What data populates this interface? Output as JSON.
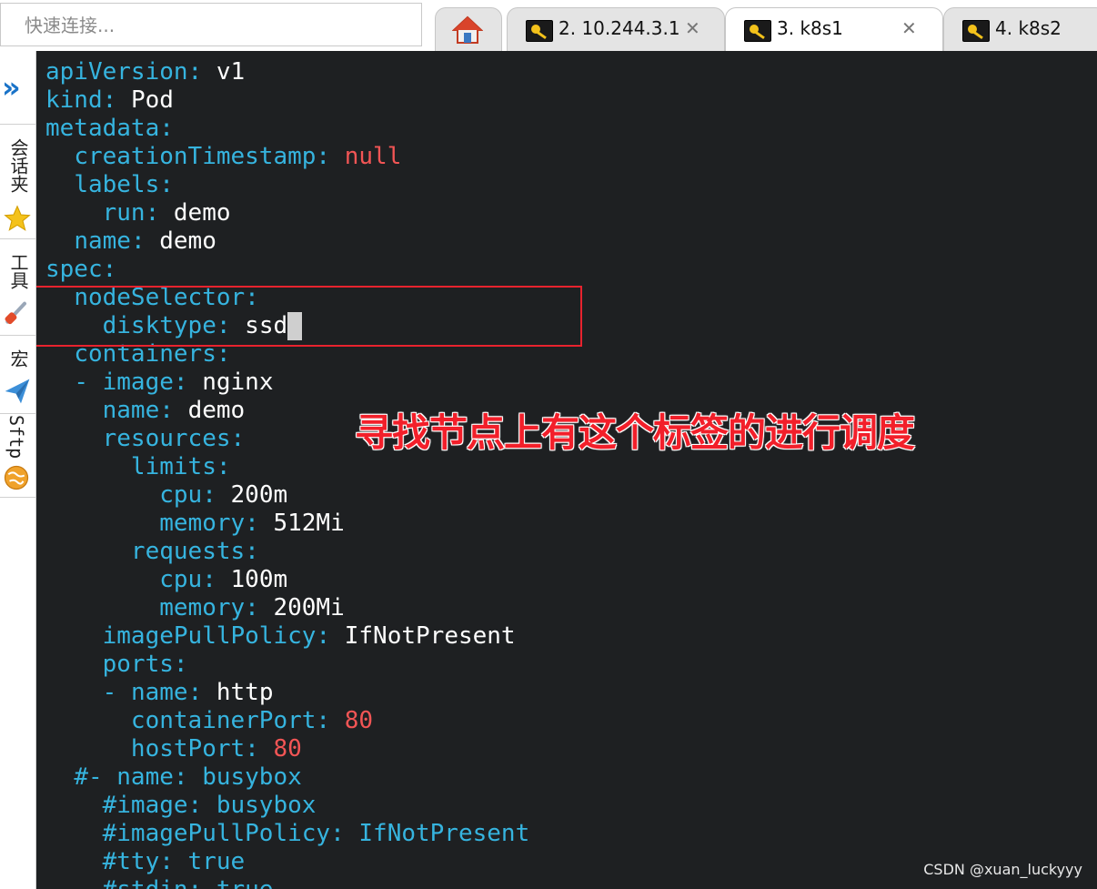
{
  "quick_connect": {
    "placeholder": "快速连接..."
  },
  "tabs": [
    {
      "label": "2. 10.244.3.1",
      "active": false
    },
    {
      "label": "3. k8s1",
      "active": true
    },
    {
      "label": "4. k8s2",
      "active": false
    }
  ],
  "icons": {
    "home": "home-icon",
    "key": "key-icon",
    "close": "close-icon",
    "chevron": "double-chevron-icon",
    "star": "star-icon",
    "tools": "wrench-icon",
    "macro": "paper-plane-icon",
    "sftp": "globe-icon"
  },
  "sidebar": {
    "chevron": "»",
    "items": [
      {
        "label": "会话夹"
      },
      {
        "label": "工具"
      },
      {
        "label": "宏"
      },
      {
        "label": "Sftp"
      }
    ]
  },
  "editor": {
    "colors": {
      "key": "#36b4df",
      "value": "#ffffff",
      "number": "#f25555",
      "background": "#1e2022",
      "highlight": "#e8232e"
    },
    "lines": [
      [
        [
          "k",
          "apiVersion"
        ],
        [
          "k",
          ": "
        ],
        [
          "v",
          "v1"
        ]
      ],
      [
        [
          "k",
          "kind"
        ],
        [
          "k",
          ": "
        ],
        [
          "v",
          "Pod"
        ]
      ],
      [
        [
          "k",
          "metadata"
        ],
        [
          "k",
          ":"
        ]
      ],
      [
        [
          "v",
          "  "
        ],
        [
          "k",
          "creationTimestamp"
        ],
        [
          "k",
          ": "
        ],
        [
          "r",
          "null"
        ]
      ],
      [
        [
          "v",
          "  "
        ],
        [
          "k",
          "labels"
        ],
        [
          "k",
          ":"
        ]
      ],
      [
        [
          "v",
          "    "
        ],
        [
          "k",
          "run"
        ],
        [
          "k",
          ": "
        ],
        [
          "v",
          "demo"
        ]
      ],
      [
        [
          "v",
          "  "
        ],
        [
          "k",
          "name"
        ],
        [
          "k",
          ": "
        ],
        [
          "v",
          "demo"
        ]
      ],
      [
        [
          "k",
          "spec"
        ],
        [
          "k",
          ":"
        ]
      ],
      [
        [
          "v",
          "  "
        ],
        [
          "k",
          "nodeSelector"
        ],
        [
          "k",
          ":"
        ]
      ],
      [
        [
          "v",
          "    "
        ],
        [
          "k",
          "disktype"
        ],
        [
          "k",
          ": "
        ],
        [
          "v",
          "ssd"
        ]
      ],
      [
        [
          "v",
          "  "
        ],
        [
          "k",
          "containers"
        ],
        [
          "k",
          ":"
        ]
      ],
      [
        [
          "v",
          "  "
        ],
        [
          "k",
          "- "
        ],
        [
          "k",
          "image"
        ],
        [
          "k",
          ": "
        ],
        [
          "v",
          "nginx"
        ]
      ],
      [
        [
          "v",
          "    "
        ],
        [
          "k",
          "name"
        ],
        [
          "k",
          ": "
        ],
        [
          "v",
          "demo"
        ]
      ],
      [
        [
          "v",
          "    "
        ],
        [
          "k",
          "resources"
        ],
        [
          "k",
          ":"
        ]
      ],
      [
        [
          "v",
          "      "
        ],
        [
          "k",
          "limits"
        ],
        [
          "k",
          ":"
        ]
      ],
      [
        [
          "v",
          "        "
        ],
        [
          "k",
          "cpu"
        ],
        [
          "k",
          ": "
        ],
        [
          "v",
          "200m"
        ]
      ],
      [
        [
          "v",
          "        "
        ],
        [
          "k",
          "memory"
        ],
        [
          "k",
          ": "
        ],
        [
          "v",
          "512Mi"
        ]
      ],
      [
        [
          "v",
          "      "
        ],
        [
          "k",
          "requests"
        ],
        [
          "k",
          ":"
        ]
      ],
      [
        [
          "v",
          "        "
        ],
        [
          "k",
          "cpu"
        ],
        [
          "k",
          ": "
        ],
        [
          "v",
          "100m"
        ]
      ],
      [
        [
          "v",
          "        "
        ],
        [
          "k",
          "memory"
        ],
        [
          "k",
          ": "
        ],
        [
          "v",
          "200Mi"
        ]
      ],
      [
        [
          "v",
          "    "
        ],
        [
          "k",
          "imagePullPolicy"
        ],
        [
          "k",
          ": "
        ],
        [
          "v",
          "IfNotPresent"
        ]
      ],
      [
        [
          "v",
          "    "
        ],
        [
          "k",
          "ports"
        ],
        [
          "k",
          ":"
        ]
      ],
      [
        [
          "v",
          "    "
        ],
        [
          "k",
          "- "
        ],
        [
          "k",
          "name"
        ],
        [
          "k",
          ": "
        ],
        [
          "v",
          "http"
        ]
      ],
      [
        [
          "v",
          "      "
        ],
        [
          "k",
          "containerPort"
        ],
        [
          "k",
          ": "
        ],
        [
          "r",
          "80"
        ]
      ],
      [
        [
          "v",
          "      "
        ],
        [
          "k",
          "hostPort"
        ],
        [
          "k",
          ": "
        ],
        [
          "r",
          "80"
        ]
      ],
      [
        [
          "v",
          "  "
        ],
        [
          "c",
          "#- name: busybox"
        ]
      ],
      [
        [
          "v",
          "    "
        ],
        [
          "c",
          "#image: busybox"
        ]
      ],
      [
        [
          "v",
          "    "
        ],
        [
          "c",
          "#imagePullPolicy: IfNotPresent"
        ]
      ],
      [
        [
          "v",
          "    "
        ],
        [
          "c",
          "#tty: true"
        ]
      ],
      [
        [
          "v",
          "    "
        ],
        [
          "c",
          "#stdin: true"
        ]
      ]
    ],
    "cursor_line": 9
  },
  "annotation": {
    "text": "寻找节点上有这个标签的进行调度"
  },
  "watermark": {
    "text": "CSDN @xuan_luckyyy"
  }
}
